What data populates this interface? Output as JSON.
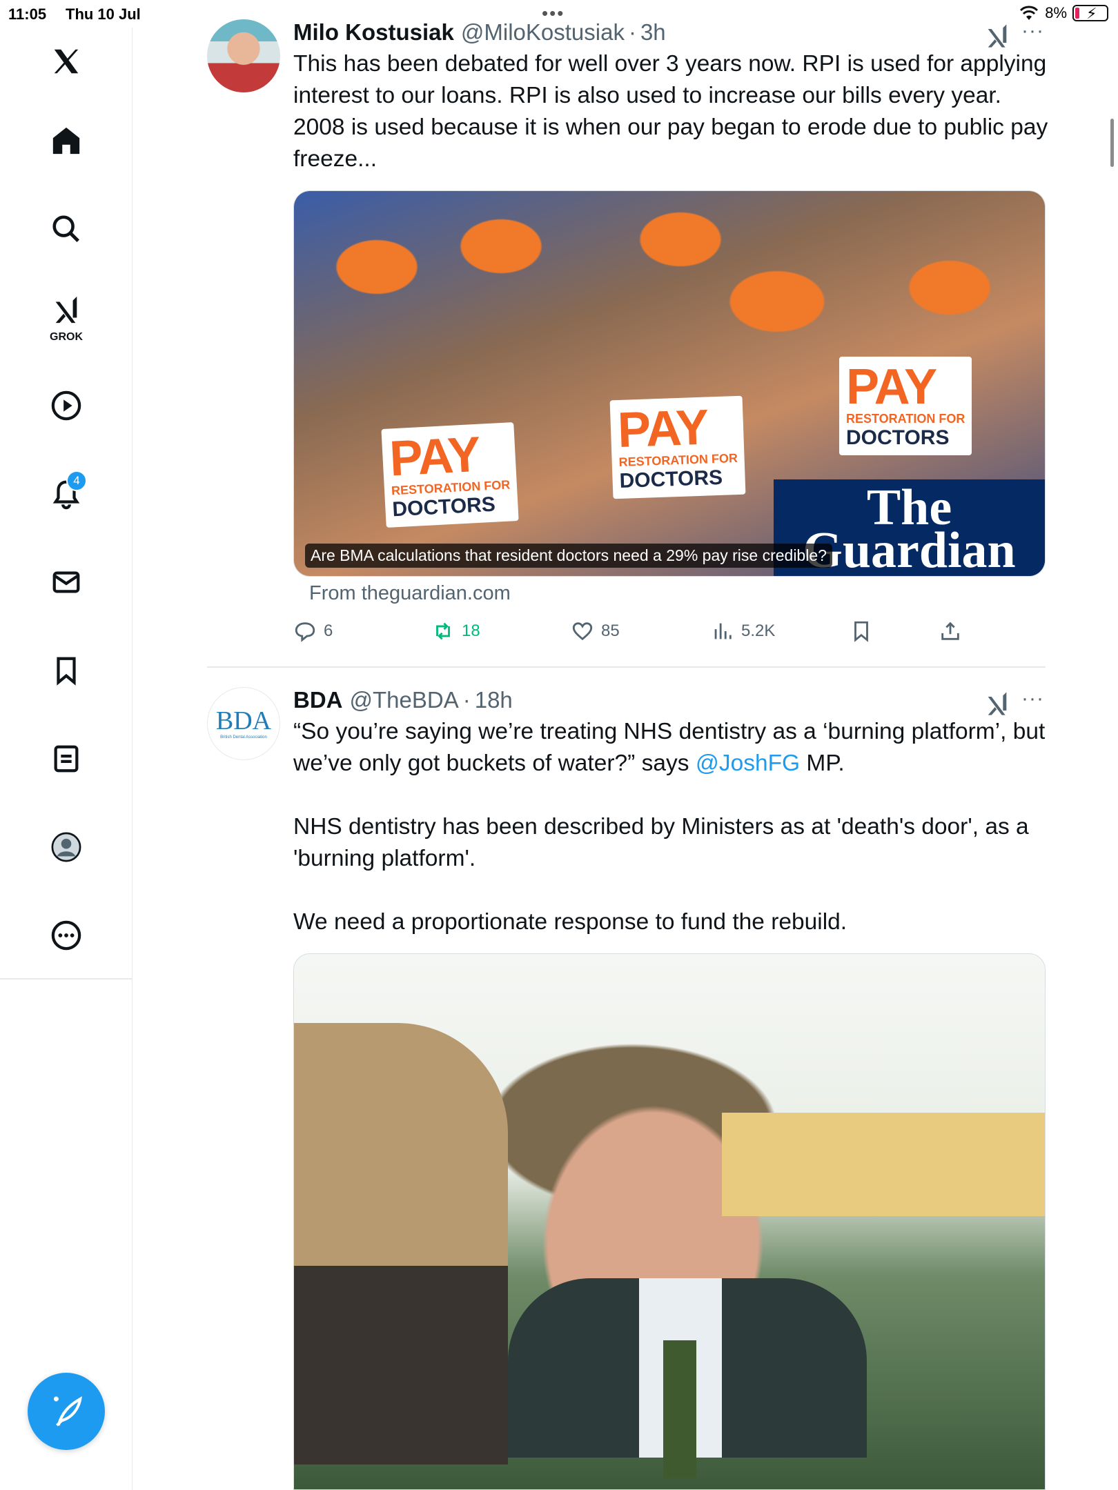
{
  "status_bar": {
    "time": "11:05",
    "date": "Thu 10 Jul",
    "battery": "8%",
    "wifi_icon": "wifi-icon",
    "battery_icon": "battery-charging-icon"
  },
  "sidebar": {
    "items": [
      {
        "icon": "x-logo-icon",
        "label": ""
      },
      {
        "icon": "home-icon",
        "label": ""
      },
      {
        "icon": "search-icon",
        "label": ""
      },
      {
        "icon": "grok-icon",
        "label": "GROK"
      },
      {
        "icon": "video-icon",
        "label": ""
      },
      {
        "icon": "notifications-icon",
        "label": "",
        "badge": "4"
      },
      {
        "icon": "messages-icon",
        "label": ""
      },
      {
        "icon": "bookmarks-icon",
        "label": ""
      },
      {
        "icon": "lists-icon",
        "label": ""
      },
      {
        "icon": "profile-icon",
        "label": ""
      },
      {
        "icon": "more-icon",
        "label": ""
      }
    ],
    "compose_icon": "compose-post-icon"
  },
  "tweets": [
    {
      "name": "Milo Kostusiak",
      "handle": "@MiloKostusiak",
      "separator": "·",
      "time": "3h",
      "text": "This has been debated for well over 3 years now. RPI is used for applying interest to our loans. RPI is also used to increase our bills every year. 2008 is used because it is when our pay began to erode due to public pay freeze...",
      "card": {
        "caption": "Are BMA calculations that resident doctors need a 29% pay rise credible?",
        "from": "From theguardian.com",
        "brand": "The Guardian",
        "placard_big": "PAY",
        "placard_small": "RESTORATION FOR",
        "placard_doctors": "DOCTORS"
      },
      "actions": {
        "replies": "6",
        "reposts": "18",
        "likes": "85",
        "views": "5.2K"
      }
    },
    {
      "name": "BDA",
      "handle": "@TheBDA",
      "separator": "·",
      "time": "18h",
      "avatar_text": "BDA",
      "avatar_sub": "British Dental Association",
      "text_part1": "“So you’re saying we’re treating NHS dentistry as a ‘burning platform’, but we’ve only got buckets of water?” says ",
      "mention": "@JoshFG",
      "text_part2": " MP.",
      "text_para2": "NHS dentistry has been described by Ministers as at 'death's door', as a 'burning platform'.",
      "text_para3": "We need a proportionate response to fund the rebuild."
    }
  ],
  "colors": {
    "accent": "#1d9bf0",
    "repost_green": "#00ba7c",
    "secondary_text": "#536471",
    "guardian_navy": "#052962",
    "bma_orange": "#f26522"
  }
}
